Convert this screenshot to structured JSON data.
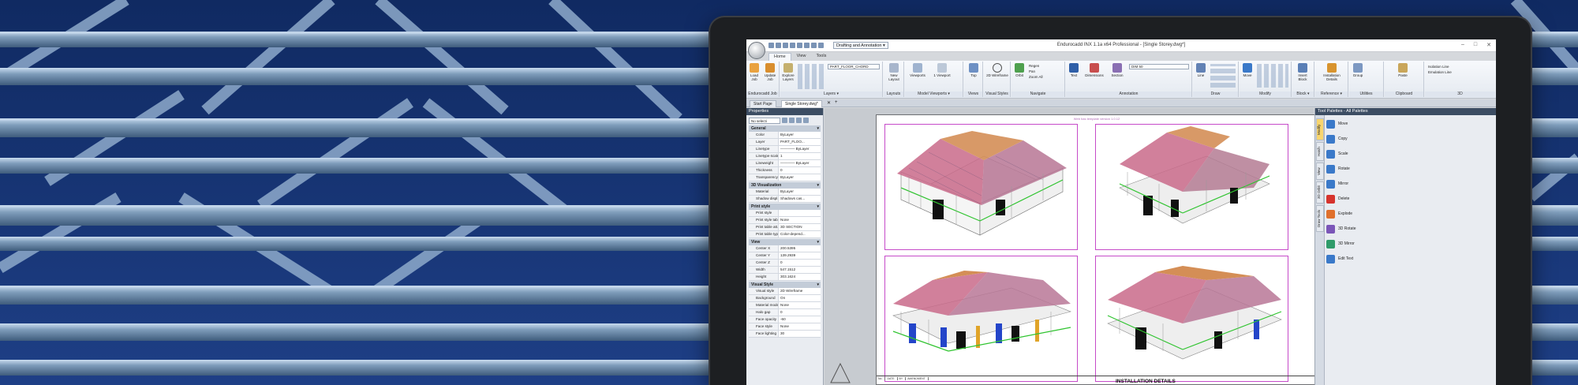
{
  "app": {
    "title": "Endurocadd INX 1.1a x64 Professional - [Single Storey.dwg*]",
    "workspace": "Drafting and Annotation",
    "window_controls": [
      "–",
      "□",
      "✕"
    ]
  },
  "ribbon": {
    "tabs": [
      {
        "label": "Home",
        "active": true
      },
      {
        "label": "View",
        "active": false
      },
      {
        "label": "Tools",
        "active": false
      }
    ],
    "panels": [
      {
        "label": "Endurocadd Job",
        "buttons": [
          "Load Job",
          "Update Job"
        ]
      },
      {
        "label": "Layers ▾",
        "buttons": [
          "Explore Layers"
        ],
        "layer_combo": "PART_FLOOR_CHORD"
      },
      {
        "label": "Layouts",
        "buttons": [
          "New Layout"
        ]
      },
      {
        "label": "Model Viewports ▾",
        "buttons": [
          "Viewports",
          "1 Viewport"
        ]
      },
      {
        "label": "Views",
        "buttons": [
          "Top"
        ]
      },
      {
        "label": "Visual Styles",
        "buttons": [
          "2D Wireframe"
        ]
      },
      {
        "label": "Navigate",
        "buttons": [
          "Orbit",
          "Regen",
          "Pan",
          "Zoom All"
        ]
      },
      {
        "label": "Annotation",
        "buttons": [
          "Text",
          "Dimensions",
          "Section"
        ],
        "dim_combo": "DIM 50"
      },
      {
        "label": "Draw",
        "buttons": [
          "Line"
        ]
      },
      {
        "label": "Modify",
        "buttons": [
          "Move"
        ]
      },
      {
        "label": "Block ▾",
        "buttons": [
          "Insert Block"
        ]
      },
      {
        "label": "Reference ▾",
        "buttons": [
          "Installation Details"
        ]
      },
      {
        "label": "Utilities",
        "buttons": [
          "Group"
        ]
      },
      {
        "label": "Clipboard",
        "buttons": [
          "Paste"
        ]
      },
      {
        "label": "3D",
        "buttons": [
          "Isolation Line",
          "Emulation Line"
        ]
      }
    ]
  },
  "doc_tabs": [
    {
      "label": "Start Page",
      "active": false
    },
    {
      "label": "Single Storey.dwg*",
      "active": true
    }
  ],
  "properties": {
    "title": "Properties",
    "selection": "No selecti",
    "sections": [
      {
        "name": "General",
        "rows": [
          [
            "Color",
            "ByLayer"
          ],
          [
            "Layer",
            "PART_FLOO..."
          ],
          [
            "Linetype",
            "———— ByLayer"
          ],
          [
            "Linetype scale",
            "1"
          ],
          [
            "Lineweight",
            "———— ByLayer"
          ],
          [
            "Thickness",
            "0"
          ],
          [
            "Transparency",
            "ByLayer"
          ]
        ]
      },
      {
        "name": "3D Visualization",
        "rows": [
          [
            "Material",
            "ByLayer"
          ],
          [
            "Shadow displ...",
            "Shadows cas..."
          ]
        ]
      },
      {
        "name": "Print style",
        "rows": [
          [
            "Print style",
            ""
          ],
          [
            "Print style table",
            "None"
          ],
          [
            "Print table att...",
            "3D SECTION"
          ],
          [
            "Print table type",
            "Color-depend..."
          ]
        ]
      },
      {
        "name": "View",
        "rows": [
          [
            "Center X",
            "200.5395"
          ],
          [
            "Center Y",
            "139.2939"
          ],
          [
            "Center Z",
            "0"
          ],
          [
            "Width",
            "547.1512"
          ],
          [
            "Height",
            "303.1624"
          ]
        ]
      },
      {
        "name": "Visual Style",
        "rows": [
          [
            "Visual style",
            "2D Wireframe"
          ],
          [
            "Background",
            "On"
          ],
          [
            "Material mode",
            "None"
          ],
          [
            "Halo gap",
            "0"
          ],
          [
            "Face opacity",
            "-60"
          ],
          [
            "Face style",
            "None"
          ],
          [
            "Face lighting",
            "30"
          ]
        ]
      }
    ]
  },
  "sheet": {
    "template_note": "Web has template version 1.0.12",
    "title_block_label": "INSTALLATION DETAILS",
    "title_cells": [
      "No.",
      "DATE",
      "BY",
      "AMENDMENT"
    ]
  },
  "tool_palettes": {
    "title": "Tool Palettes - All Palettes",
    "side_tabs": [
      "Modify",
      "Hatch",
      "View",
      "3D Orbit",
      "Draw Tools"
    ],
    "tools": [
      "Move",
      "Copy",
      "Scale",
      "Rotate",
      "Mirror",
      "Delete",
      "Explode",
      "3D Rotate",
      "3D Mirror",
      "Edit Text"
    ],
    "tool_colors": [
      "#3a79c9",
      "#3a79c9",
      "#3a79c9",
      "#3a79c9",
      "#3a79c9",
      "#d6332d",
      "#e0702c",
      "#7b56b8",
      "#2f9b6a",
      "#3a79c9"
    ]
  },
  "colors": {
    "accent": "#3c4d63",
    "viewport_border": "#c64bc9"
  }
}
